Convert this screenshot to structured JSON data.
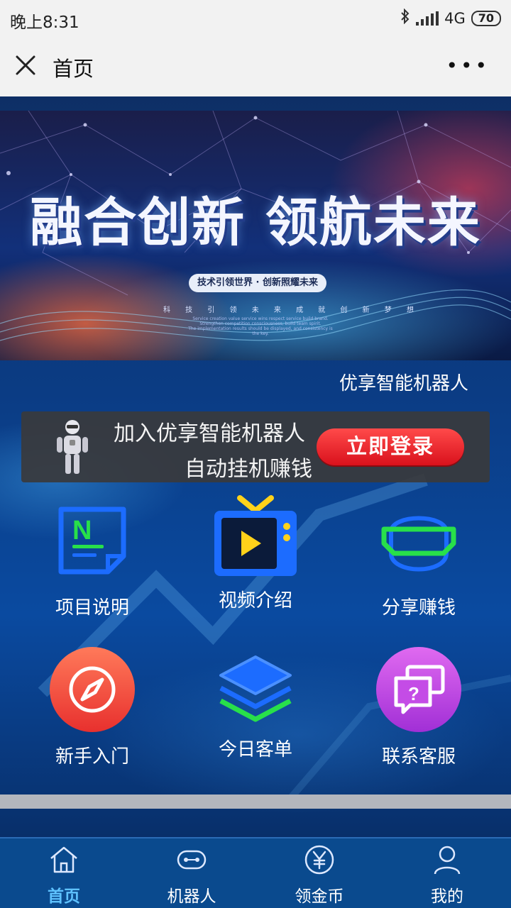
{
  "status_bar": {
    "time": "晚上8:31",
    "network": "4G",
    "battery": "70"
  },
  "nav_bar": {
    "title": "首页",
    "close_icon": "close-icon",
    "more_icon": "more-icon"
  },
  "banner": {
    "headline": "融合创新 领航未来",
    "tagline": "技术引领世界 · 创新照耀未来",
    "small_text": "科 技 引 领 未 来      成 就 创 新 梦 想",
    "fine_print": [
      "Service creation value service wins respect service build brand.",
      "Strengthen competition consciousness, build team spirit.",
      "The implementation results should be displayed, and consistency is the key."
    ]
  },
  "brand_label": "优享智能机器人",
  "promo": {
    "line1": "加入优享智能机器人",
    "line2": "自动挂机赚钱",
    "button_label": "立即登录"
  },
  "menu": {
    "items": [
      {
        "label": "项目说明",
        "icon": "document-n-icon"
      },
      {
        "label": "视频介绍",
        "icon": "tv-play-icon"
      },
      {
        "label": "分享赚钱",
        "icon": "vr-headset-icon"
      },
      {
        "label": "新手入门",
        "icon": "compass-icon"
      },
      {
        "label": "今日客单",
        "icon": "layers-icon"
      },
      {
        "label": "联系客服",
        "icon": "chat-question-icon"
      }
    ]
  },
  "tabbar": {
    "items": [
      {
        "label": "首页",
        "icon": "home-icon",
        "active": true
      },
      {
        "label": "机器人",
        "icon": "robot-icon",
        "active": false
      },
      {
        "label": "领金币",
        "icon": "yen-coin-icon",
        "active": false
      },
      {
        "label": "我的",
        "icon": "user-icon",
        "active": false
      }
    ]
  },
  "colors": {
    "tab_active": "#5fc2ff",
    "login_button": "#e01820",
    "tabbar_bg": "#0a4a8e"
  }
}
